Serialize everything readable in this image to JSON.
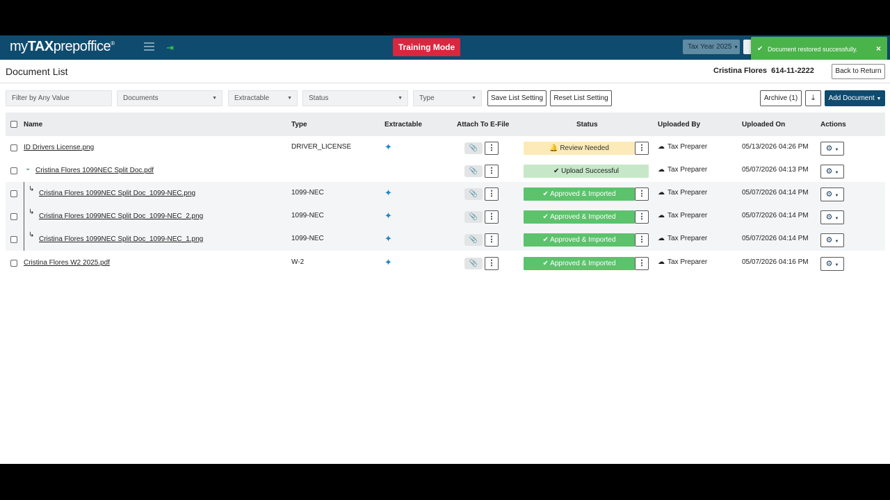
{
  "header": {
    "logo_prefix": "my",
    "logo_bold": "TAX",
    "logo_suffix": "prepoffice",
    "logo_reg": "®",
    "training_mode": "Training Mode",
    "tax_year": "Tax Year 2025"
  },
  "toast": {
    "message": "Document restored successfully.",
    "close": "×",
    "color": "#4ab34a"
  },
  "page": {
    "title": "Document List",
    "client": "Cristina Flores  614-11-2222",
    "back_button": "Back to Return"
  },
  "filters": {
    "filter_any": "Filter by Any Value",
    "documents": "Documents",
    "extractable": "Extractable",
    "status": "Status",
    "type": "Type",
    "save_list": "Save List Setting",
    "reset_list": "Reset List Setting",
    "archive": "Archive (1)",
    "add_document": "Add Document"
  },
  "columns": {
    "name": "Name",
    "type": "Type",
    "extractable": "Extractable",
    "attach": "Attach To E-File",
    "status": "Status",
    "uploaded_by": "Uploaded By",
    "uploaded_on": "Uploaded On",
    "actions": "Actions"
  },
  "rows": [
    {
      "name": "ID Drivers License.png",
      "type": "DRIVER_LICENSE",
      "status": "Review Needed",
      "uploaded_by": "Tax Preparer",
      "uploaded_on": "05/13/2026 04:26 PM"
    },
    {
      "name": "Cristina Flores 1099NEC Split Doc.pdf",
      "type": "",
      "status": "Upload Successful",
      "uploaded_by": "Tax Preparer",
      "uploaded_on": "05/07/2026 04:13 PM"
    },
    {
      "name": "Cristina Flores 1099NEC Split Doc_1099-NEC.png",
      "type": "1099-NEC",
      "status": "Approved & Imported",
      "uploaded_by": "Tax Preparer",
      "uploaded_on": "05/07/2026 04:14 PM"
    },
    {
      "name": "Cristina Flores 1099NEC Split Doc_1099-NEC_2.png",
      "type": "1099-NEC",
      "status": "Approved & Imported",
      "uploaded_by": "Tax Preparer",
      "uploaded_on": "05/07/2026 04:14 PM"
    },
    {
      "name": "Cristina Flores 1099NEC Split Doc_1099-NEC_1.png",
      "type": "1099-NEC",
      "status": "Approved & Imported",
      "uploaded_by": "Tax Preparer",
      "uploaded_on": "05/07/2026 04:14 PM"
    },
    {
      "name": "Cristina Flores W2 2025.pdf",
      "type": "W-2",
      "status": "Approved & Imported",
      "uploaded_by": "Tax Preparer",
      "uploaded_on": "05/07/2026 04:16 PM"
    }
  ],
  "colors": {
    "header": "#0f4b6e",
    "training": "#d8273e",
    "approved": "#5cc26c",
    "review": "#fcebb8",
    "upload": "#c6e8c8"
  }
}
